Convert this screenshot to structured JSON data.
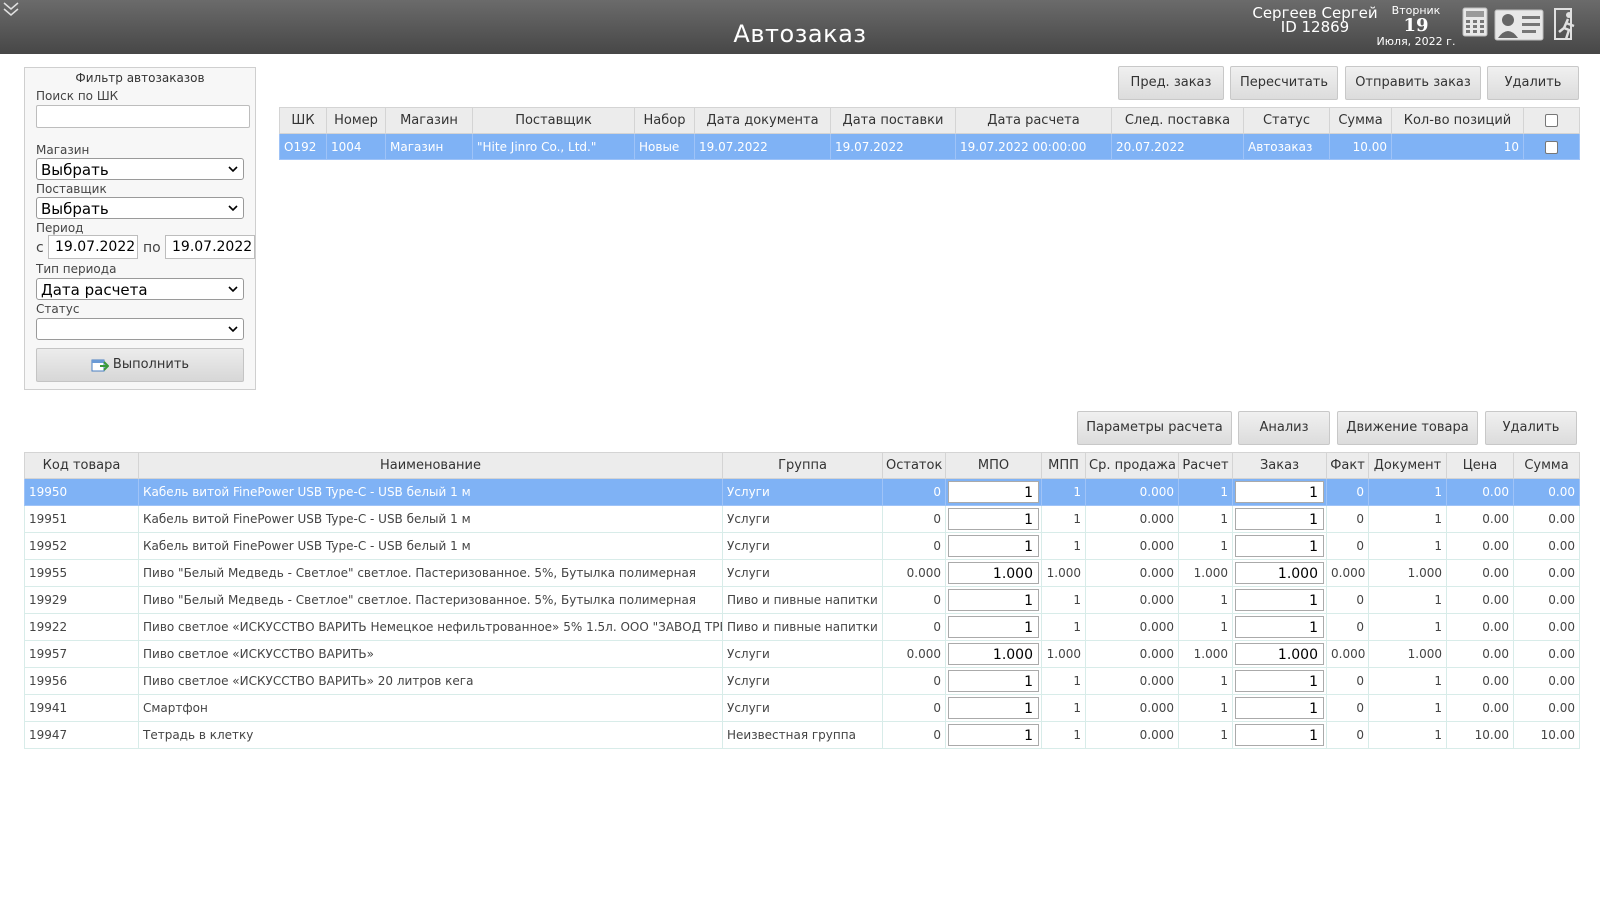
{
  "header": {
    "title": "Автозаказ",
    "user_name": "Сергеев Сергей",
    "user_id": "ID 12869",
    "weekday": "Вторник",
    "day": "19",
    "month_year": "Июля, 2022 г."
  },
  "filter": {
    "title": "Фильтр автозаказов",
    "barcode_label": "Поиск по ШК",
    "barcode_value": "",
    "store_label": "Магазин",
    "store_value": "Выбрать",
    "supplier_label": "Поставщик",
    "supplier_value": "Выбрать",
    "period_label": "Период",
    "from_label": "с",
    "from_value": "19.07.2022",
    "to_label": "по",
    "to_value": "19.07.2022",
    "period_type_label": "Тип периода",
    "period_type_value": "Дата расчета",
    "status_label": "Статус",
    "status_value": "",
    "run_label": "Выполнить"
  },
  "orders_toolbar": {
    "prev_order": "Пред. заказ",
    "recalc": "Пересчитать",
    "send_order": "Отправить заказ",
    "delete": "Удалить"
  },
  "orders_table": {
    "headers": [
      "ШК",
      "Номер",
      "Магазин",
      "Поставщик",
      "Набор",
      "Дата документа",
      "Дата поставки",
      "Дата расчета",
      "След. поставка",
      "Статус",
      "Сумма",
      "Кол-во позиций"
    ],
    "rows": [
      {
        "barcode": "O192",
        "number": "1004",
        "store": "Магазин",
        "supplier": "\"Hite Jinro Co., Ltd.\"",
        "set": "Новые",
        "doc_date": "19.07.2022",
        "delivery_date": "19.07.2022",
        "calc_date": "19.07.2022 00:00:00",
        "next_delivery": "20.07.2022",
        "status": "Автозаказ",
        "sum": "10.00",
        "positions": "10"
      }
    ]
  },
  "items_toolbar": {
    "calc_params": "Параметры расчета",
    "analysis": "Анализ",
    "movement": "Движение товара",
    "delete": "Удалить"
  },
  "items_table": {
    "headers": [
      "Код товара",
      "Наименование",
      "Группа",
      "Остаток",
      "МПО",
      "МПП",
      "Ср. продажа",
      "Расчет",
      "Заказ",
      "Факт",
      "Документ",
      "Цена",
      "Сумма"
    ],
    "rows": [
      {
        "code": "19950",
        "name": "Кабель витой FinePower USB Type-C - USB белый 1 м",
        "group": "Услуги",
        "rest": "0",
        "mpo": "1",
        "mpp": "1",
        "avg": "0.000",
        "calc": "1",
        "order": "1",
        "fact": "0",
        "doc": "1",
        "price": "0.00",
        "sum": "0.00"
      },
      {
        "code": "19951",
        "name": "Кабель витой FinePower USB Type-C - USB белый 1 м",
        "group": "Услуги",
        "rest": "0",
        "mpo": "1",
        "mpp": "1",
        "avg": "0.000",
        "calc": "1",
        "order": "1",
        "fact": "0",
        "doc": "1",
        "price": "0.00",
        "sum": "0.00"
      },
      {
        "code": "19952",
        "name": "Кабель витой FinePower USB Type-C - USB белый 1 м",
        "group": "Услуги",
        "rest": "0",
        "mpo": "1",
        "mpp": "1",
        "avg": "0.000",
        "calc": "1",
        "order": "1",
        "fact": "0",
        "doc": "1",
        "price": "0.00",
        "sum": "0.00"
      },
      {
        "code": "19955",
        "name": "Пиво \"Белый Медведь - Светлое\" светлое. Пастеризованное. 5%, Бутылка полимерная",
        "group": "Услуги",
        "rest": "0.000",
        "mpo": "1.000",
        "mpp": "1.000",
        "avg": "0.000",
        "calc": "1.000",
        "order": "1.000",
        "fact": "0.000",
        "doc": "1.000",
        "price": "0.00",
        "sum": "0.00"
      },
      {
        "code": "19929",
        "name": "Пиво \"Белый Медведь - Светлое\" светлое. Пастеризованное. 5%, Бутылка полимерная",
        "group": "Пиво и пивные напитки",
        "rest": "0",
        "mpo": "1",
        "mpp": "1",
        "avg": "0.000",
        "calc": "1",
        "order": "1",
        "fact": "0",
        "doc": "1",
        "price": "0.00",
        "sum": "0.00"
      },
      {
        "code": "19922",
        "name": "Пиво светлое «ИСКУССТВО ВАРИТЬ Немецкое нефильтрованное» 5% 1.5л. ООО \"ЗАВОД ТРЕ",
        "group": "Пиво и пивные напитки",
        "rest": "0",
        "mpo": "1",
        "mpp": "1",
        "avg": "0.000",
        "calc": "1",
        "order": "1",
        "fact": "0",
        "doc": "1",
        "price": "0.00",
        "sum": "0.00"
      },
      {
        "code": "19957",
        "name": "Пиво светлое «ИСКУССТВО ВАРИТЬ»",
        "group": "Услуги",
        "rest": "0.000",
        "mpo": "1.000",
        "mpp": "1.000",
        "avg": "0.000",
        "calc": "1.000",
        "order": "1.000",
        "fact": "0.000",
        "doc": "1.000",
        "price": "0.00",
        "sum": "0.00"
      },
      {
        "code": "19956",
        "name": "Пиво светлое «ИСКУССТВО ВАРИТЬ» 20 литров кега",
        "group": "Услуги",
        "rest": "0",
        "mpo": "1",
        "mpp": "1",
        "avg": "0.000",
        "calc": "1",
        "order": "1",
        "fact": "0",
        "doc": "1",
        "price": "0.00",
        "sum": "0.00"
      },
      {
        "code": "19941",
        "name": "Смартфон",
        "group": "Услуги",
        "rest": "0",
        "mpo": "1",
        "mpp": "1",
        "avg": "0.000",
        "calc": "1",
        "order": "1",
        "fact": "0",
        "doc": "1",
        "price": "0.00",
        "sum": "0.00"
      },
      {
        "code": "19947",
        "name": "Тетрадь в клетку",
        "group": "Неизвестная группа",
        "rest": "0",
        "mpo": "1",
        "mpp": "1",
        "avg": "0.000",
        "calc": "1",
        "order": "1",
        "fact": "0",
        "doc": "1",
        "price": "10.00",
        "sum": "10.00"
      }
    ]
  }
}
